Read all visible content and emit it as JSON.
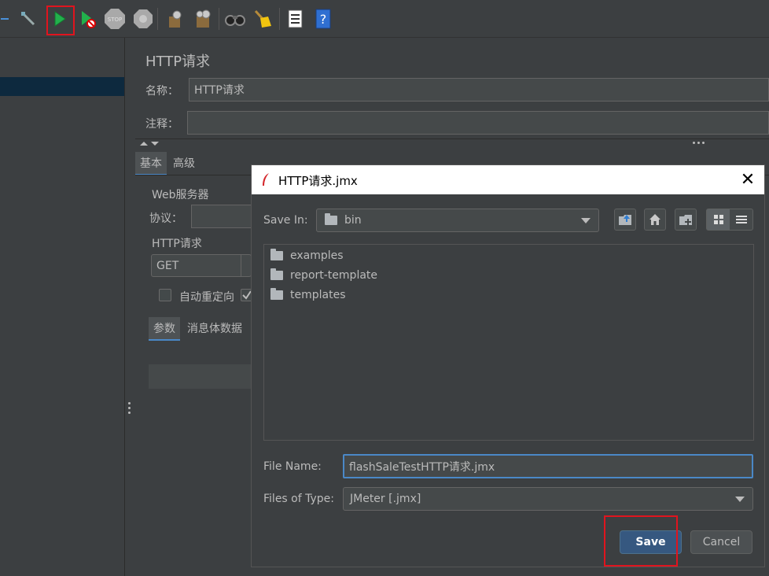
{
  "panel": {
    "title": "HTTP请求",
    "name_label": "名称：",
    "name_value": "HTTP请求",
    "comment_label": "注释：",
    "tabs": [
      "基本",
      "高级"
    ],
    "web_server_label": "Web服务器",
    "protocol_label": "协议：",
    "http_request_label": "HTTP请求",
    "method_value": "GET",
    "auto_redirect_label": "自动重定向",
    "subtabs": [
      "参数",
      "消息体数据"
    ]
  },
  "dialog": {
    "title": "HTTP请求.jmx",
    "save_in_label": "Save In:",
    "save_in_value": "bin",
    "files": [
      "examples",
      "report-template",
      "templates"
    ],
    "file_name_label": "File Name:",
    "file_name_value": "flashSaleTestHTTP请求.jmx",
    "files_of_type_label": "Files of Type:",
    "files_of_type_value": "JMeter [.jmx]",
    "save_label": "Save",
    "cancel_label": "Cancel"
  },
  "colors": {
    "background": "#3c3f41",
    "dialog_title_bg": "#ffffff",
    "primary_button": "#365880",
    "highlight_box": "#e0141e",
    "tree_selection": "#0d293e"
  },
  "toolbar_icons": [
    "collapse-icon",
    "toggle-icon",
    "start-icon",
    "start-no-pauses-icon",
    "stop-icon",
    "shutdown-icon",
    "clear-icon",
    "clear-all-icon",
    "search-icon",
    "reset-search-icon",
    "function-helper-icon",
    "help-icon"
  ]
}
